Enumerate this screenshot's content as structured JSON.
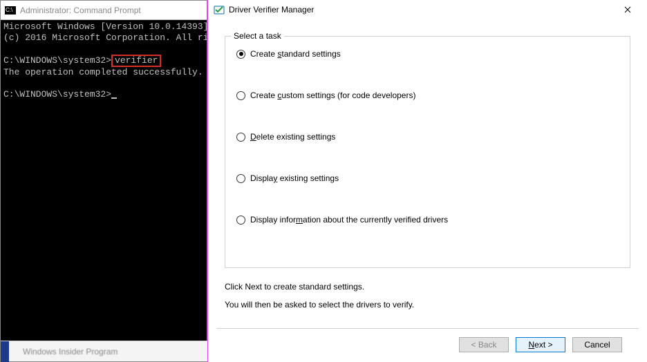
{
  "cmd": {
    "title": "Administrator: Command Prompt",
    "line1": "Microsoft Windows [Version 10.0.14393]",
    "line2": "(c) 2016 Microsoft Corporation. All ri",
    "prompt1": "C:\\WINDOWS\\system32>",
    "command": "verifier",
    "result": "The operation completed successfully.",
    "prompt2": "C:\\WINDOWS\\system32>",
    "taskbar_blur": "Windows Insider Program"
  },
  "dvm": {
    "title": "Driver Verifier Manager",
    "group_label": "Select a task",
    "options": [
      {
        "pre": "Create ",
        "accel": "s",
        "post": "tandard settings",
        "selected": true
      },
      {
        "pre": "Create ",
        "accel": "c",
        "post": "ustom settings (for code developers)",
        "selected": false
      },
      {
        "pre": "",
        "accel": "D",
        "post": "elete existing settings",
        "selected": false
      },
      {
        "pre": "Displa",
        "accel": "y",
        "post": " existing settings",
        "selected": false
      },
      {
        "pre": "Display infor",
        "accel": "m",
        "post": "ation about the currently verified drivers",
        "selected": false
      }
    ],
    "instruction1": "Click Next to create standard settings.",
    "instruction2": "You will then be asked to select the drivers to verify.",
    "back": "< Back",
    "next_pre": "",
    "next_accel": "N",
    "next_post": "ext >",
    "cancel": "Cancel"
  }
}
